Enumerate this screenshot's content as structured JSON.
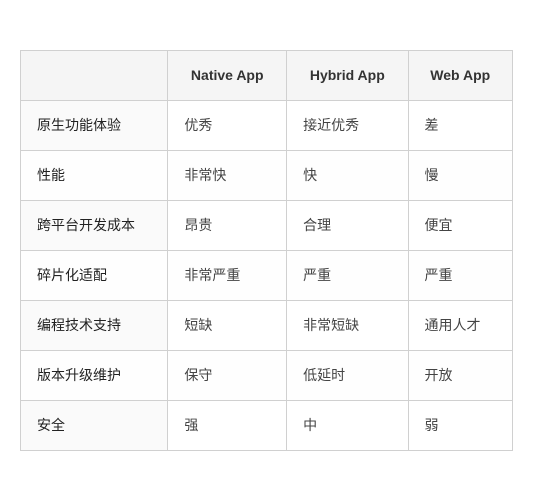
{
  "table": {
    "headers": [
      "",
      "Native App",
      "Hybrid App",
      "Web App"
    ],
    "rows": [
      {
        "label": "原生功能体验",
        "native": "优秀",
        "hybrid": "接近优秀",
        "web": "差"
      },
      {
        "label": "性能",
        "native": "非常快",
        "hybrid": "快",
        "web": "慢"
      },
      {
        "label": "跨平台开发成本",
        "native": "昂贵",
        "hybrid": "合理",
        "web": "便宜"
      },
      {
        "label": "碎片化适配",
        "native": "非常严重",
        "hybrid": "严重",
        "web": "严重"
      },
      {
        "label": "编程技术支持",
        "native": "短缺",
        "hybrid": "非常短缺",
        "web": "通用人才"
      },
      {
        "label": "版本升级维护",
        "native": "保守",
        "hybrid": "低延时",
        "web": "开放"
      },
      {
        "label": "安全",
        "native": "强",
        "hybrid": "中",
        "web": "弱"
      }
    ]
  }
}
